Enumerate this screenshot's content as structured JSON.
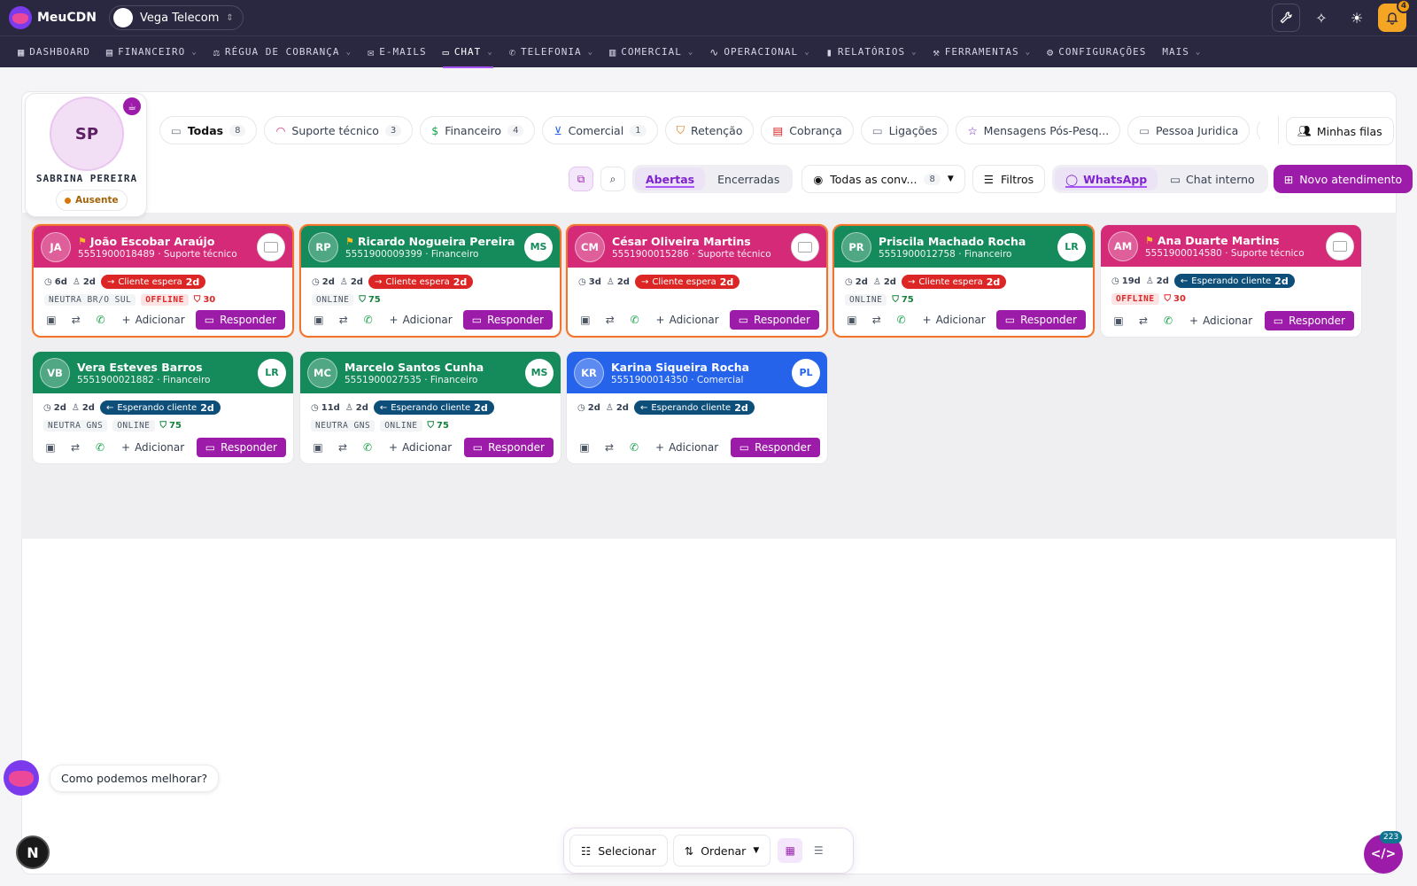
{
  "app": {
    "name": "MeuCDN",
    "company": "Vega Telecom",
    "notif_count": "4"
  },
  "nav": [
    {
      "label": "DASHBOARD",
      "icon": "grid-icon",
      "caret": false
    },
    {
      "label": "FINANCEIRO",
      "icon": "receipt-icon",
      "caret": true
    },
    {
      "label": "RÉGUA DE COBRANÇA",
      "icon": "scale-icon",
      "caret": true
    },
    {
      "label": "E-MAILS",
      "icon": "mail-icon",
      "caret": false
    },
    {
      "label": "CHAT",
      "icon": "chat-icon",
      "caret": true,
      "active": true
    },
    {
      "label": "TELEFONIA",
      "icon": "phone-icon",
      "caret": true
    },
    {
      "label": "COMERCIAL",
      "icon": "store-icon",
      "caret": true
    },
    {
      "label": "OPERACIONAL",
      "icon": "activity-icon",
      "caret": true
    },
    {
      "label": "RELATÓRIOS",
      "icon": "chart-icon",
      "caret": true
    },
    {
      "label": "FERRAMENTAS",
      "icon": "wrench-icon",
      "caret": true
    },
    {
      "label": "CONFIGURAÇÕES",
      "icon": "gear-icon",
      "caret": false
    },
    {
      "label": "MAIS",
      "icon": "",
      "caret": true
    }
  ],
  "profile": {
    "initials": "SP",
    "name": "SABRINA PEREIRA",
    "status": "Ausente"
  },
  "queues": [
    {
      "label": "Todas",
      "count": "8",
      "icon": "inbox-icon",
      "active": true
    },
    {
      "label": "Suporte técnico",
      "count": "3",
      "icon": "headset-icon"
    },
    {
      "label": "Financeiro",
      "count": "4",
      "icon": "dollar-icon"
    },
    {
      "label": "Comercial",
      "count": "1",
      "icon": "cart-icon"
    },
    {
      "label": "Retenção",
      "count": "",
      "icon": "shield-icon"
    },
    {
      "label": "Cobrança",
      "count": "",
      "icon": "document-icon"
    },
    {
      "label": "Ligações",
      "count": "",
      "icon": "inbox-icon"
    },
    {
      "label": "Mensagens Pós-Pesq...",
      "count": "",
      "icon": "star-icon"
    },
    {
      "label": "Pessoa Juridica",
      "count": "",
      "icon": "inbox-icon"
    },
    {
      "label": "",
      "count": "",
      "icon": "inbox-icon"
    }
  ],
  "minhas_filas": "Minhas filas",
  "toolbar": {
    "abertas": "Abertas",
    "encerradas": "Encerradas",
    "conversas": "Todas as conv...",
    "conversas_count": "8",
    "filtros": "Filtros",
    "whatsapp": "WhatsApp",
    "chat_interno": "Chat interno",
    "novo": "Novo atendimento"
  },
  "card_actions": {
    "add": "Adicionar",
    "respond": "Responder"
  },
  "cards": [
    {
      "initials": "JA",
      "name": "João Escobar Araújo",
      "flag": true,
      "phone": "5551900018489",
      "queue": "Suporte técnico",
      "agent": "",
      "color": "pink",
      "highlight": true,
      "time": "6d",
      "agent_time": "2d",
      "wait_type": "Cliente espera",
      "wait_time": "2d",
      "wait_color": "red",
      "tags": [
        "NEUTRA BR/O SUL",
        "OFFLINE"
      ],
      "score": "30",
      "score_color": "red"
    },
    {
      "initials": "RP",
      "name": "Ricardo Nogueira Pereira",
      "flag": true,
      "phone": "5551900009399",
      "queue": "Financeiro",
      "agent": "MS",
      "color": "green",
      "highlight": true,
      "time": "2d",
      "agent_time": "2d",
      "wait_type": "Cliente espera",
      "wait_time": "2d",
      "wait_color": "red",
      "tags": [
        "ONLINE"
      ],
      "score": "75",
      "score_color": "green"
    },
    {
      "initials": "CM",
      "name": "César Oliveira Martins",
      "flag": false,
      "phone": "5551900015286",
      "queue": "Suporte técnico",
      "agent": "",
      "color": "pink",
      "highlight": true,
      "time": "3d",
      "agent_time": "2d",
      "wait_type": "Cliente espera",
      "wait_time": "2d",
      "wait_color": "red",
      "tags": [],
      "score": "",
      "score_color": ""
    },
    {
      "initials": "PR",
      "name": "Priscila Machado Rocha",
      "flag": false,
      "phone": "5551900012758",
      "queue": "Financeiro",
      "agent": "LR",
      "color": "green",
      "highlight": true,
      "time": "2d",
      "agent_time": "2d",
      "wait_type": "Cliente espera",
      "wait_time": "2d",
      "wait_color": "red",
      "tags": [
        "ONLINE"
      ],
      "score": "75",
      "score_color": "green"
    },
    {
      "initials": "AM",
      "name": "Ana Duarte Martins",
      "flag": true,
      "phone": "5551900014580",
      "queue": "Suporte técnico",
      "agent": "",
      "color": "pink",
      "highlight": false,
      "time": "19d",
      "agent_time": "2d",
      "wait_type": "Esperando cliente",
      "wait_time": "2d",
      "wait_color": "dark",
      "tags": [
        "OFFLINE"
      ],
      "score": "30",
      "score_color": "red"
    },
    {
      "initials": "VB",
      "name": "Vera Esteves Barros",
      "flag": false,
      "phone": "5551900021882",
      "queue": "Financeiro",
      "agent": "LR",
      "color": "green",
      "highlight": false,
      "time": "2d",
      "agent_time": "2d",
      "wait_type": "Esperando cliente",
      "wait_time": "2d",
      "wait_color": "dark",
      "tags": [
        "NEUTRA GNS",
        "ONLINE"
      ],
      "score": "75",
      "score_color": "green"
    },
    {
      "initials": "MC",
      "name": "Marcelo Santos Cunha",
      "flag": false,
      "phone": "5551900027535",
      "queue": "Financeiro",
      "agent": "MS",
      "color": "green",
      "highlight": false,
      "time": "11d",
      "agent_time": "2d",
      "wait_type": "Esperando cliente",
      "wait_time": "2d",
      "wait_color": "dark",
      "tags": [
        "NEUTRA GNS",
        "ONLINE"
      ],
      "score": "75",
      "score_color": "green"
    },
    {
      "initials": "KR",
      "name": "Karina Siqueira Rocha",
      "flag": false,
      "phone": "5551900014350",
      "queue": "Comercial",
      "agent": "PL",
      "color": "blue",
      "highlight": false,
      "time": "2d",
      "agent_time": "2d",
      "wait_type": "Esperando cliente",
      "wait_time": "2d",
      "wait_color": "dark",
      "tags": [],
      "score": "",
      "score_color": ""
    }
  ],
  "feedback": "Como podemos melhorar?",
  "bottom": {
    "select": "Selecionar",
    "order": "Ordenar"
  },
  "dev_badge": "223",
  "colors": {
    "brand": "#9c1ba8",
    "nav_bg": "#2a2840",
    "pink": "#d42a78",
    "green": "#158a5b",
    "blue": "#2563eb",
    "highlight_border": "#ef7430"
  }
}
